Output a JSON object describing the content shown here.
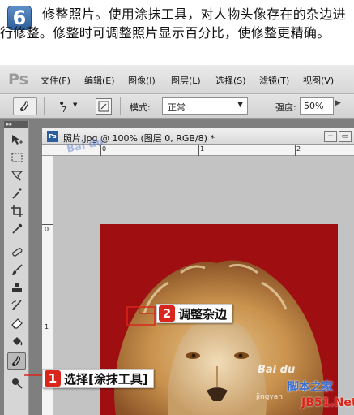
{
  "step": {
    "number": "6",
    "text": "修整照片。使用涂抹工具，对人物头像存在的杂边进行修整。修整时可调整照片显示百分比，使修整更精确。"
  },
  "menubar": {
    "logo": "Ps",
    "items": [
      "文件(F)",
      "编辑(E)",
      "图像(I)",
      "图层(L)",
      "选择(S)",
      "滤镜(T)",
      "视图(V)"
    ]
  },
  "options": {
    "brush_size": "7",
    "mode_label": "模式:",
    "mode_value": "正常",
    "strength_label": "强度:",
    "strength_value": "50%"
  },
  "document": {
    "title": "照片.jpg @ 100% (图层 0, RGB/8) *",
    "ruler_top": [
      "0",
      "1",
      "2"
    ],
    "ruler_left": [
      "0",
      "1"
    ]
  },
  "toolbox": {
    "tools": [
      "move-icon",
      "marquee-icon",
      "lasso-icon",
      "magic-wand-icon",
      "crop-icon",
      "eyedropper-icon",
      "healing-icon",
      "brush-icon",
      "stamp-icon",
      "history-brush-icon",
      "eraser-icon",
      "paint-bucket-icon",
      "smudge-icon",
      "dodge-icon"
    ],
    "active_tool": "smudge-icon"
  },
  "callouts": {
    "c1_num": "1",
    "c1_text": "选择[涂抹工具]",
    "c2_num": "2",
    "c2_text": "调整杂边"
  },
  "watermark": {
    "baidu": "Bai du",
    "site_cn": "脚本之家",
    "site_en": "JB51.Net",
    "jingyan": "jingyan"
  },
  "colors": {
    "photo_background": "#9f0f12",
    "callout_accent": "#d9261c"
  }
}
